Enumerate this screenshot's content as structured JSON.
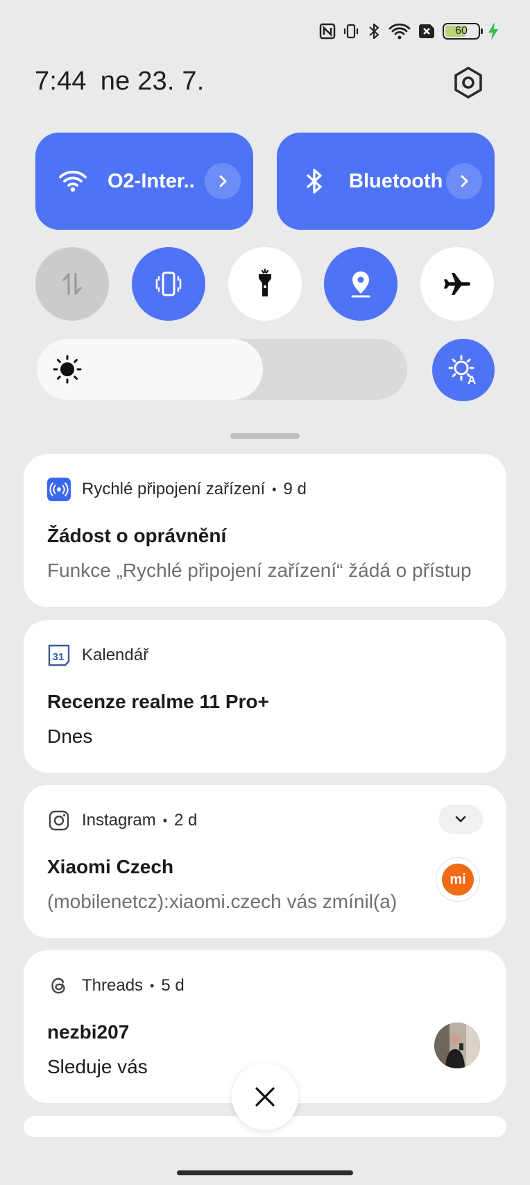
{
  "status_bar": {
    "battery_level": "60",
    "icons": [
      "nfc-icon",
      "vibrate-icon",
      "bluetooth-icon",
      "wifi-icon",
      "sim-missing-icon",
      "battery-icon",
      "charging-icon"
    ]
  },
  "header": {
    "time": "7:44",
    "date": "ne 23. 7."
  },
  "quick_tiles": {
    "wifi_label": "O2-Inter..",
    "bluetooth_label": "Bluetooth",
    "mobile_data_on": false,
    "vibrate_on": true,
    "flashlight_on": false,
    "location_on": true,
    "airplane_on": false
  },
  "brightness": {
    "level_percent": 61,
    "auto": true
  },
  "notifications": [
    {
      "app": "Rychlé připojení zařízení",
      "age": "9 d",
      "title": "Žádost o oprávnění",
      "body": "Funkce „Rychlé připojení zařízení“ žádá o přístup"
    },
    {
      "app": "Kalendář",
      "age": "",
      "icon_text": "31",
      "title": "Recenze realme 11 Pro+",
      "body": "Dnes"
    },
    {
      "app": "Instagram",
      "age": "2 d",
      "title": "Xiaomi Czech",
      "body": "(mobilenetcz):xiaomi.czech vás zmínil(a)",
      "thumb_text": "mi"
    },
    {
      "app": "Threads",
      "age": "5 d",
      "title": "nezbi207",
      "body": "Sleduje vás"
    }
  ],
  "colors": {
    "accent": "#4f73f5",
    "background": "#e8eaeb",
    "card": "#ffffff",
    "xiaomi_orange": "#f26a14"
  }
}
